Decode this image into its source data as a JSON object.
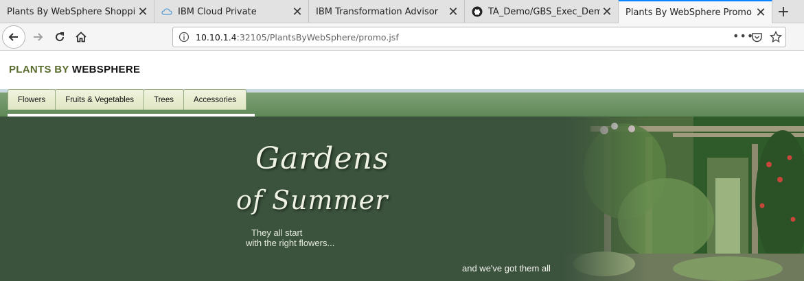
{
  "browser": {
    "tabs": [
      {
        "title": "Plants By WebSphere Shopping",
        "active": false
      },
      {
        "title": "IBM Cloud Private",
        "active": false
      },
      {
        "title": "IBM Transformation Advisor",
        "active": false
      },
      {
        "title": "TA_Demo/GBS_Exec_Demo/S",
        "active": false
      },
      {
        "title": "Plants By WebSphere Promo",
        "active": true
      }
    ],
    "url_host": "10.10.1.4",
    "url_rest": ":32105/PlantsByWebSphere/promo.jsf",
    "more_label": "•••"
  },
  "site": {
    "brand_part1": "PLANTS BY",
    "brand_part2": "WEBSPHERE",
    "nav": [
      "Flowers",
      "Fruits & Vegetables",
      "Trees",
      "Accessories"
    ]
  },
  "banner": {
    "title_line1": "Gardens",
    "title_line2": "of Summer",
    "tagline1": "They all start",
    "tagline2": "with the right flowers...",
    "tagline3": "and we've got them all"
  },
  "colors": {
    "accent": "#0a84ff",
    "brand_green": "#5a6b2e",
    "banner_bg": "#3b523d",
    "nav_green": "#5f8858"
  }
}
